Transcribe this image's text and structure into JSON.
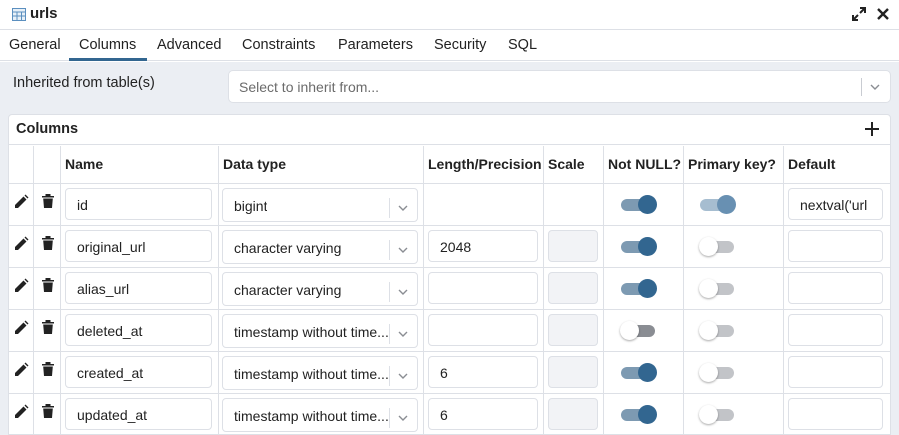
{
  "window": {
    "title": "urls"
  },
  "tabs": [
    "General",
    "Columns",
    "Advanced",
    "Constraints",
    "Parameters",
    "Security",
    "SQL"
  ],
  "active_tab": "Columns",
  "inherit": {
    "label": "Inherited from table(s)",
    "placeholder": "Select to inherit from..."
  },
  "columns_panel": {
    "title": "Columns",
    "headers": [
      "Name",
      "Data type",
      "Length/Precision",
      "Scale",
      "Not NULL?",
      "Primary key?",
      "Default"
    ],
    "rows": [
      {
        "name": "id",
        "data_type": "bigint",
        "length": "",
        "scale": "",
        "not_null": true,
        "primary_key": true,
        "default": "nextval('url"
      },
      {
        "name": "original_url",
        "data_type": "character varying",
        "length": "2048",
        "scale": "",
        "not_null": true,
        "primary_key": false,
        "default": ""
      },
      {
        "name": "alias_url",
        "data_type": "character varying",
        "length": "",
        "scale": "",
        "not_null": true,
        "primary_key": false,
        "default": ""
      },
      {
        "name": "deleted_at",
        "data_type": "timestamp without time...",
        "length": "",
        "scale": "",
        "not_null": false,
        "primary_key": false,
        "default": ""
      },
      {
        "name": "created_at",
        "data_type": "timestamp without time...",
        "length": "6",
        "scale": "",
        "not_null": true,
        "primary_key": false,
        "default": ""
      },
      {
        "name": "updated_at",
        "data_type": "timestamp without time...",
        "length": "6",
        "scale": "",
        "not_null": true,
        "primary_key": false,
        "default": ""
      }
    ]
  },
  "icons": {
    "table": "table-icon",
    "expand": "expand-icon",
    "close": "close-icon",
    "add": "plus-icon",
    "edit": "pencil-icon",
    "delete": "trash-icon",
    "dropdown": "chevron-down-icon"
  },
  "colors": {
    "accent": "#326690",
    "toggle_on_track": "#7d9ab2",
    "panel_bg": "#ebeef3",
    "border": "#dde0e6"
  }
}
